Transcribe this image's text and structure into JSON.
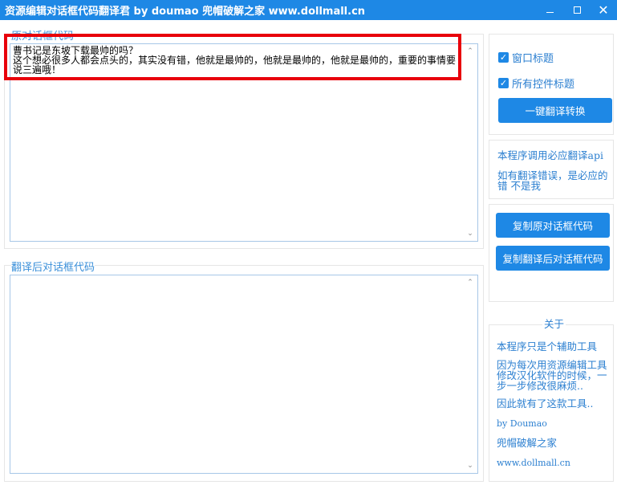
{
  "window": {
    "title": "资源编辑对话框代码翻译君 by doumao 兜帽破解之家 www.dollmall.cn",
    "minimize_icon": "minimize-icon",
    "maximize_icon": "maximize-icon",
    "close_icon": "close-icon",
    "close_glyph": "✕"
  },
  "original": {
    "label": "原对话框代码",
    "text": "曹书记是东坡下载最帅的吗？\n这个想必很多人都会点头的，其实没有错，他就是最帅的，他就是最帅的，他就是最帅的，重要的事情要说三遍哦！"
  },
  "translated": {
    "label": "翻译后对话框代码",
    "text": ""
  },
  "options": {
    "window_title_label": "窗口标题",
    "window_title_checked": true,
    "all_controls_label": "所有控件标题",
    "all_controls_checked": true,
    "check_glyph": "✓",
    "translate_button": "一键翻译转换"
  },
  "notes": {
    "api_line": "本程序调用必应翻译api",
    "error_line": "如有翻译错误，是必应的错 不是我"
  },
  "copy": {
    "copy_original": "复制原对话框代码",
    "copy_translated": "复制翻译后对话框代码"
  },
  "about": {
    "title": "关于",
    "line1": "本程序只是个辅助工具",
    "line2": "因为每次用资源编辑工具修改汉化软件的时候，一步一步修改很麻烦..",
    "line3": "因此就有了这款工具..",
    "line4": "by Doumao",
    "line5": "兜帽破解之家",
    "line6": "www.dollmall.cn"
  },
  "scroll": {
    "up_glyph": "⌃",
    "down_glyph": "⌄"
  },
  "colors": {
    "accent": "#1e88e5",
    "label_blue": "#3a8fd9",
    "highlight_red": "#e8000b"
  }
}
